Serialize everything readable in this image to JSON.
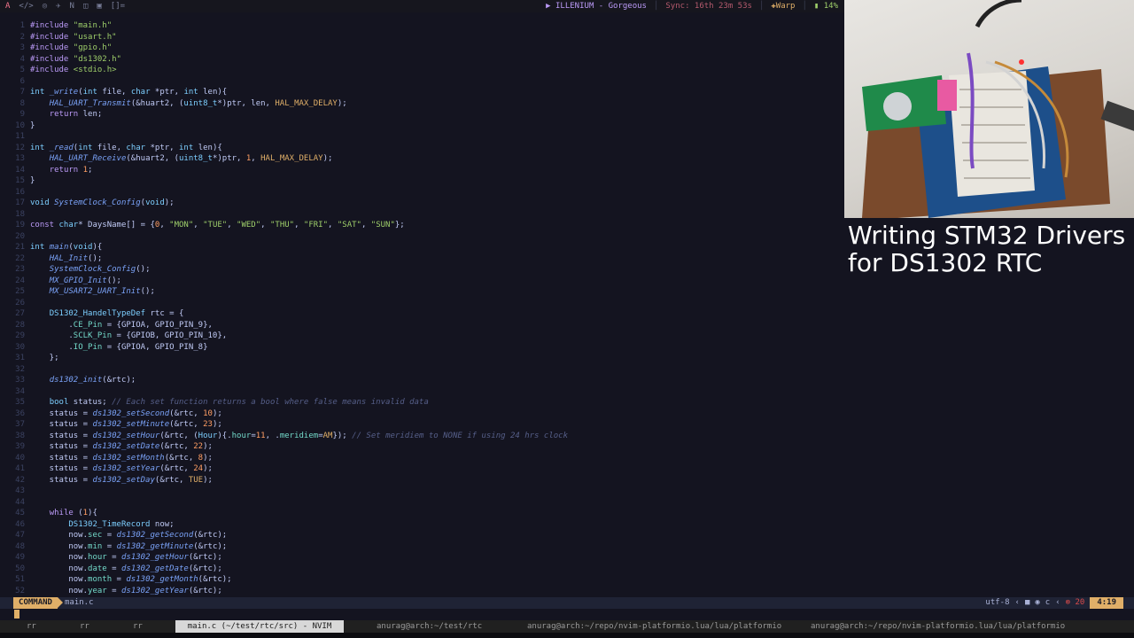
{
  "topbar": {
    "workspaces": [
      "A",
      "</>",
      "◎",
      "✈",
      "N",
      "◫",
      "▣",
      "[]="
    ],
    "music": "▶ ILLENIUM - Gorgeous",
    "sync": "Sync: 16th 23m 53s",
    "warp": "Warp",
    "battery": "14%"
  },
  "overlay": {
    "title_line1": "Writing STM32 Drivers",
    "title_line2": "for DS1302 RTC"
  },
  "statusline": {
    "mode": "COMMAND",
    "file": "main.c",
    "encoding": "utf-8",
    "filetype": "c",
    "diagnostics": "20",
    "position": "4:19"
  },
  "taskbar": {
    "items": [
      "rr",
      "rr",
      "rr",
      "main.c (~/test/rtc/src) - NVIM",
      "anurag@arch:~/test/rtc",
      "anurag@arch:~/repo/nvim-platformio.lua/lua/platformio",
      "anurag@arch:~/repo/nvim-platformio.lua/lua/platformio"
    ]
  },
  "code_lines": [
    [
      {
        "t": "#include ",
        "c": "pp"
      },
      {
        "t": "\"main.h\"",
        "c": "st"
      }
    ],
    [
      {
        "t": "#include ",
        "c": "pp"
      },
      {
        "t": "\"usart.h\"",
        "c": "st"
      }
    ],
    [
      {
        "t": "#include ",
        "c": "pp"
      },
      {
        "t": "\"gpio.h\"",
        "c": "st"
      }
    ],
    [
      {
        "t": "#include ",
        "c": "pp"
      },
      {
        "t": "\"ds1302.h\"",
        "c": "st"
      }
    ],
    [
      {
        "t": "#include ",
        "c": "pp"
      },
      {
        "t": "<stdio.h>",
        "c": "st"
      }
    ],
    [],
    [
      {
        "t": "int ",
        "c": "ty"
      },
      {
        "t": "_write",
        "c": "fn"
      },
      {
        "t": "(",
        "c": ""
      },
      {
        "t": "int ",
        "c": "ty"
      },
      {
        "t": "file, ",
        "c": ""
      },
      {
        "t": "char ",
        "c": "ty"
      },
      {
        "t": "*ptr, ",
        "c": ""
      },
      {
        "t": "int ",
        "c": "ty"
      },
      {
        "t": "len){",
        "c": ""
      }
    ],
    [
      {
        "t": "    ",
        "c": ""
      },
      {
        "t": "HAL_UART_Transmit",
        "c": "fn"
      },
      {
        "t": "(&huart2, (",
        "c": ""
      },
      {
        "t": "uint8_t",
        "c": "ty"
      },
      {
        "t": "*)ptr, len, ",
        "c": ""
      },
      {
        "t": "HAL_MAX_DELAY",
        "c": "mc"
      },
      {
        "t": ");",
        "c": ""
      }
    ],
    [
      {
        "t": "    ",
        "c": ""
      },
      {
        "t": "return ",
        "c": "k"
      },
      {
        "t": "len;",
        "c": ""
      }
    ],
    [
      {
        "t": "}",
        "c": ""
      }
    ],
    [],
    [
      {
        "t": "int ",
        "c": "ty"
      },
      {
        "t": "_read",
        "c": "fn"
      },
      {
        "t": "(",
        "c": ""
      },
      {
        "t": "int ",
        "c": "ty"
      },
      {
        "t": "file, ",
        "c": ""
      },
      {
        "t": "char ",
        "c": "ty"
      },
      {
        "t": "*ptr, ",
        "c": ""
      },
      {
        "t": "int ",
        "c": "ty"
      },
      {
        "t": "len){",
        "c": ""
      }
    ],
    [
      {
        "t": "    ",
        "c": ""
      },
      {
        "t": "HAL_UART_Receive",
        "c": "fn"
      },
      {
        "t": "(&huart2, (",
        "c": ""
      },
      {
        "t": "uint8_t",
        "c": "ty"
      },
      {
        "t": "*)ptr, ",
        "c": ""
      },
      {
        "t": "1",
        "c": "nm"
      },
      {
        "t": ", ",
        "c": ""
      },
      {
        "t": "HAL_MAX_DELAY",
        "c": "mc"
      },
      {
        "t": ");",
        "c": ""
      }
    ],
    [
      {
        "t": "    ",
        "c": ""
      },
      {
        "t": "return ",
        "c": "k"
      },
      {
        "t": "1",
        "c": "nm"
      },
      {
        "t": ";",
        "c": ""
      }
    ],
    [
      {
        "t": "}",
        "c": ""
      }
    ],
    [],
    [
      {
        "t": "void ",
        "c": "ty"
      },
      {
        "t": "SystemClock_Config",
        "c": "fn"
      },
      {
        "t": "(",
        "c": ""
      },
      {
        "t": "void",
        "c": "ty"
      },
      {
        "t": ");",
        "c": ""
      }
    ],
    [],
    [
      {
        "t": "const ",
        "c": "k"
      },
      {
        "t": "char",
        "c": "ty"
      },
      {
        "t": "* DaysName[] = {",
        "c": ""
      },
      {
        "t": "0",
        "c": "nm"
      },
      {
        "t": ", ",
        "c": ""
      },
      {
        "t": "\"MON\"",
        "c": "st"
      },
      {
        "t": ", ",
        "c": ""
      },
      {
        "t": "\"TUE\"",
        "c": "st"
      },
      {
        "t": ", ",
        "c": ""
      },
      {
        "t": "\"WED\"",
        "c": "st"
      },
      {
        "t": ", ",
        "c": ""
      },
      {
        "t": "\"THU\"",
        "c": "st"
      },
      {
        "t": ", ",
        "c": ""
      },
      {
        "t": "\"FRI\"",
        "c": "st"
      },
      {
        "t": ", ",
        "c": ""
      },
      {
        "t": "\"SAT\"",
        "c": "st"
      },
      {
        "t": ", ",
        "c": ""
      },
      {
        "t": "\"SUN\"",
        "c": "st"
      },
      {
        "t": "};",
        "c": ""
      }
    ],
    [],
    [
      {
        "t": "int ",
        "c": "ty"
      },
      {
        "t": "main",
        "c": "fn"
      },
      {
        "t": "(",
        "c": ""
      },
      {
        "t": "void",
        "c": "ty"
      },
      {
        "t": "){",
        "c": ""
      }
    ],
    [
      {
        "t": "    ",
        "c": ""
      },
      {
        "t": "HAL_Init",
        "c": "fn"
      },
      {
        "t": "();",
        "c": ""
      }
    ],
    [
      {
        "t": "    ",
        "c": ""
      },
      {
        "t": "SystemClock_Config",
        "c": "fn"
      },
      {
        "t": "();",
        "c": ""
      }
    ],
    [
      {
        "t": "    ",
        "c": ""
      },
      {
        "t": "MX_GPIO_Init",
        "c": "fn"
      },
      {
        "t": "();",
        "c": ""
      }
    ],
    [
      {
        "t": "    ",
        "c": ""
      },
      {
        "t": "MX_USART2_UART_Init",
        "c": "fn"
      },
      {
        "t": "();",
        "c": ""
      }
    ],
    [],
    [
      {
        "t": "    ",
        "c": ""
      },
      {
        "t": "DS1302_HandelTypeDef ",
        "c": "ty"
      },
      {
        "t": "rtc = {",
        "c": ""
      }
    ],
    [
      {
        "t": "        .",
        "c": ""
      },
      {
        "t": "CE_Pin",
        "c": "fl"
      },
      {
        "t": " = {GPIOA, GPIO_PIN_9},",
        "c": ""
      }
    ],
    [
      {
        "t": "        .",
        "c": ""
      },
      {
        "t": "SCLK_Pin",
        "c": "fl"
      },
      {
        "t": " = {GPIOB, GPIO_PIN_10},",
        "c": ""
      }
    ],
    [
      {
        "t": "        .",
        "c": ""
      },
      {
        "t": "IO_Pin",
        "c": "fl"
      },
      {
        "t": " = {GPIOA, GPIO_PIN_8}",
        "c": ""
      }
    ],
    [
      {
        "t": "    };",
        "c": ""
      }
    ],
    [],
    [
      {
        "t": "    ",
        "c": ""
      },
      {
        "t": "ds1302_init",
        "c": "fn"
      },
      {
        "t": "(&rtc);",
        "c": ""
      }
    ],
    [],
    [
      {
        "t": "    ",
        "c": ""
      },
      {
        "t": "bool ",
        "c": "ty"
      },
      {
        "t": "status; ",
        "c": ""
      },
      {
        "t": "// Each set function returns a bool where false means invalid data",
        "c": "cm"
      }
    ],
    [
      {
        "t": "    status = ",
        "c": ""
      },
      {
        "t": "ds1302_setSecond",
        "c": "fn"
      },
      {
        "t": "(&rtc, ",
        "c": ""
      },
      {
        "t": "10",
        "c": "nm"
      },
      {
        "t": ");",
        "c": ""
      }
    ],
    [
      {
        "t": "    status = ",
        "c": ""
      },
      {
        "t": "ds1302_setMinute",
        "c": "fn"
      },
      {
        "t": "(&rtc, ",
        "c": ""
      },
      {
        "t": "23",
        "c": "nm"
      },
      {
        "t": ");",
        "c": ""
      }
    ],
    [
      {
        "t": "    status = ",
        "c": ""
      },
      {
        "t": "ds1302_setHour",
        "c": "fn"
      },
      {
        "t": "(&rtc, (",
        "c": ""
      },
      {
        "t": "Hour",
        "c": "ty"
      },
      {
        "t": "){.",
        "c": ""
      },
      {
        "t": "hour",
        "c": "fl"
      },
      {
        "t": "=",
        "c": ""
      },
      {
        "t": "11",
        "c": "nm"
      },
      {
        "t": ", .",
        "c": ""
      },
      {
        "t": "meridiem",
        "c": "fl"
      },
      {
        "t": "=",
        "c": ""
      },
      {
        "t": "AM",
        "c": "mc"
      },
      {
        "t": "}); ",
        "c": ""
      },
      {
        "t": "// Set meridiem to NONE if using 24 hrs clock",
        "c": "cm"
      }
    ],
    [
      {
        "t": "    status = ",
        "c": ""
      },
      {
        "t": "ds1302_setDate",
        "c": "fn"
      },
      {
        "t": "(&rtc, ",
        "c": ""
      },
      {
        "t": "22",
        "c": "nm"
      },
      {
        "t": ");",
        "c": ""
      }
    ],
    [
      {
        "t": "    status = ",
        "c": ""
      },
      {
        "t": "ds1302_setMonth",
        "c": "fn"
      },
      {
        "t": "(&rtc, ",
        "c": ""
      },
      {
        "t": "8",
        "c": "nm"
      },
      {
        "t": ");",
        "c": ""
      }
    ],
    [
      {
        "t": "    status = ",
        "c": ""
      },
      {
        "t": "ds1302_setYear",
        "c": "fn"
      },
      {
        "t": "(&rtc, ",
        "c": ""
      },
      {
        "t": "24",
        "c": "nm"
      },
      {
        "t": ");",
        "c": ""
      }
    ],
    [
      {
        "t": "    status = ",
        "c": ""
      },
      {
        "t": "ds1302_setDay",
        "c": "fn"
      },
      {
        "t": "(&rtc, ",
        "c": ""
      },
      {
        "t": "TUE",
        "c": "mc"
      },
      {
        "t": ");",
        "c": ""
      }
    ],
    [],
    [],
    [
      {
        "t": "    ",
        "c": ""
      },
      {
        "t": "while ",
        "c": "k"
      },
      {
        "t": "(",
        "c": ""
      },
      {
        "t": "1",
        "c": "nm"
      },
      {
        "t": "){",
        "c": ""
      }
    ],
    [
      {
        "t": "        ",
        "c": ""
      },
      {
        "t": "DS1302_TimeRecord ",
        "c": "ty"
      },
      {
        "t": "now;",
        "c": ""
      }
    ],
    [
      {
        "t": "        now.",
        "c": ""
      },
      {
        "t": "sec",
        "c": "fl"
      },
      {
        "t": " = ",
        "c": ""
      },
      {
        "t": "ds1302_getSecond",
        "c": "fn"
      },
      {
        "t": "(&rtc);",
        "c": ""
      }
    ],
    [
      {
        "t": "        now.",
        "c": ""
      },
      {
        "t": "min",
        "c": "fl"
      },
      {
        "t": " = ",
        "c": ""
      },
      {
        "t": "ds1302_getMinute",
        "c": "fn"
      },
      {
        "t": "(&rtc);",
        "c": ""
      }
    ],
    [
      {
        "t": "        now.",
        "c": ""
      },
      {
        "t": "hour",
        "c": "fl"
      },
      {
        "t": " = ",
        "c": ""
      },
      {
        "t": "ds1302_getHour",
        "c": "fn"
      },
      {
        "t": "(&rtc);",
        "c": ""
      }
    ],
    [
      {
        "t": "        now.",
        "c": ""
      },
      {
        "t": "date",
        "c": "fl"
      },
      {
        "t": " = ",
        "c": ""
      },
      {
        "t": "ds1302_getDate",
        "c": "fn"
      },
      {
        "t": "(&rtc);",
        "c": ""
      }
    ],
    [
      {
        "t": "        now.",
        "c": ""
      },
      {
        "t": "month",
        "c": "fl"
      },
      {
        "t": " = ",
        "c": ""
      },
      {
        "t": "ds1302_getMonth",
        "c": "fn"
      },
      {
        "t": "(&rtc);",
        "c": ""
      }
    ],
    [
      {
        "t": "        now.",
        "c": ""
      },
      {
        "t": "year",
        "c": "fl"
      },
      {
        "t": " = ",
        "c": ""
      },
      {
        "t": "ds1302_getYear",
        "c": "fn"
      },
      {
        "t": "(&rtc);",
        "c": ""
      }
    ]
  ]
}
